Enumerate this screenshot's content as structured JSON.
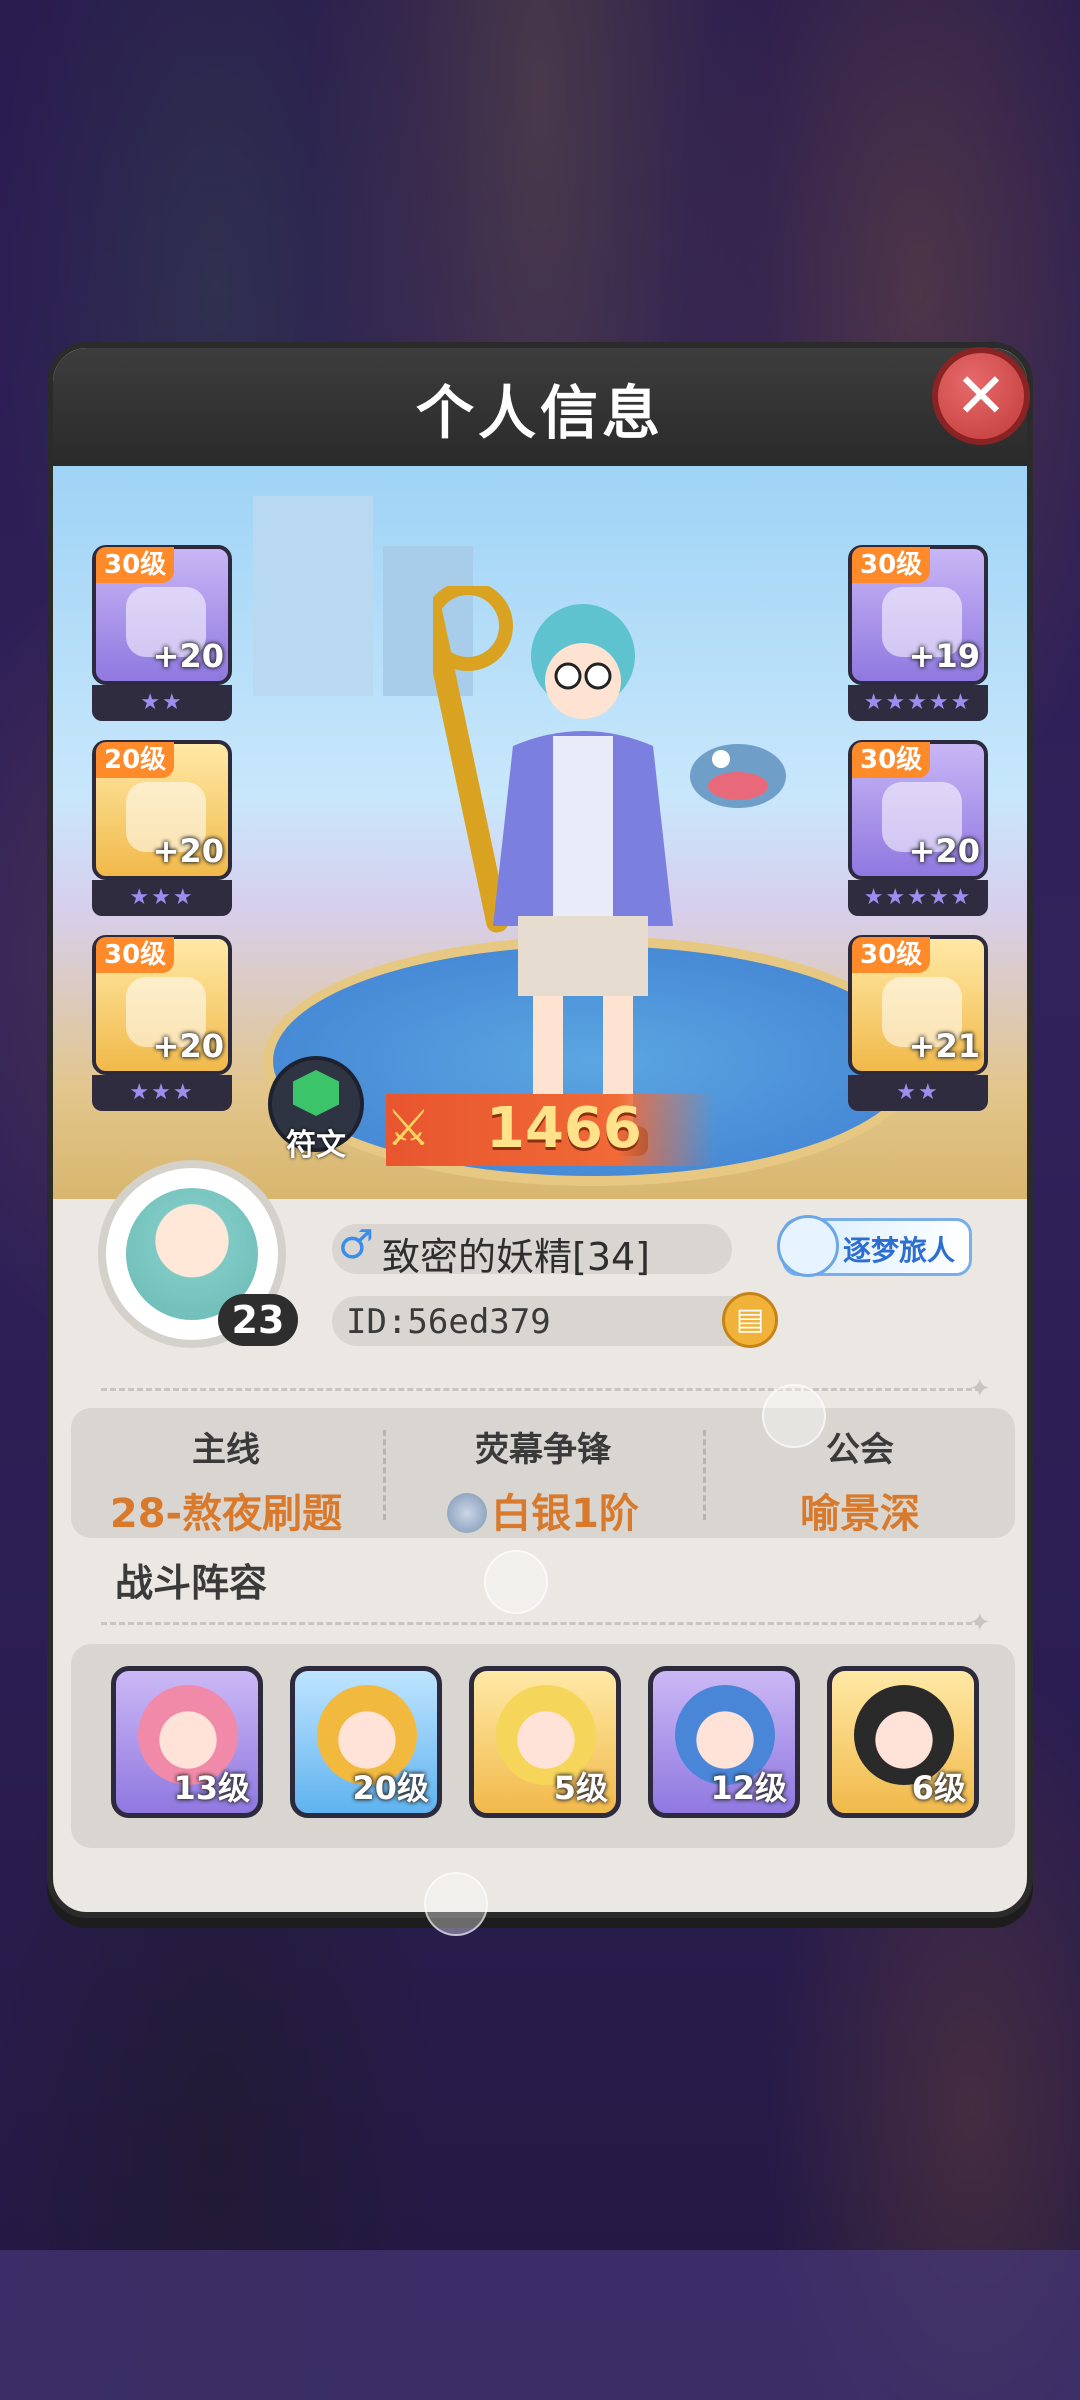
{
  "panel": {
    "title": "个人信息"
  },
  "close_icon": "close-icon",
  "equipment": {
    "left": [
      {
        "level": "30级",
        "plus": "+20",
        "stars": "★★",
        "rarity": "purple"
      },
      {
        "level": "20级",
        "plus": "+20",
        "stars": "★★★",
        "rarity": "gold"
      },
      {
        "level": "30级",
        "plus": "+20",
        "stars": "★★★",
        "rarity": "gold"
      }
    ],
    "right": [
      {
        "level": "30级",
        "plus": "+19",
        "stars": "★★★★★",
        "rarity": "purple"
      },
      {
        "level": "30级",
        "plus": "+20",
        "stars": "★★★★★",
        "rarity": "purple"
      },
      {
        "level": "30级",
        "plus": "+21",
        "stars": "★★",
        "rarity": "gold"
      }
    ]
  },
  "rune": {
    "label": "符文"
  },
  "power": {
    "value": "1466"
  },
  "profile": {
    "avatar_level": "23",
    "gender_symbol": "♂",
    "name": "致密的妖精[34]",
    "badge": "逐梦旅人",
    "id": "ID:56ed379"
  },
  "stats": [
    {
      "key": "主线",
      "value": "28-熬夜刷题"
    },
    {
      "key": "荧幕争锋",
      "value": "白银1阶"
    },
    {
      "key": "公会",
      "value": "喻景深"
    }
  ],
  "lineup": {
    "title": "战斗阵容",
    "heroes": [
      {
        "level": "13级",
        "rarity": "purple",
        "hair": "#f08aa8"
      },
      {
        "level": "20级",
        "rarity": "blue",
        "hair": "#f2b93f"
      },
      {
        "level": "5级",
        "rarity": "gold",
        "hair": "#f5d55a"
      },
      {
        "level": "12级",
        "rarity": "purple",
        "hair": "#4a86d8"
      },
      {
        "level": "6级",
        "rarity": "gold",
        "hair": "#2a2a2a"
      }
    ]
  },
  "colors": {
    "accent_orange": "#d9792c",
    "power_red": "#e8552f",
    "gender_blue": "#3a8ee8"
  }
}
